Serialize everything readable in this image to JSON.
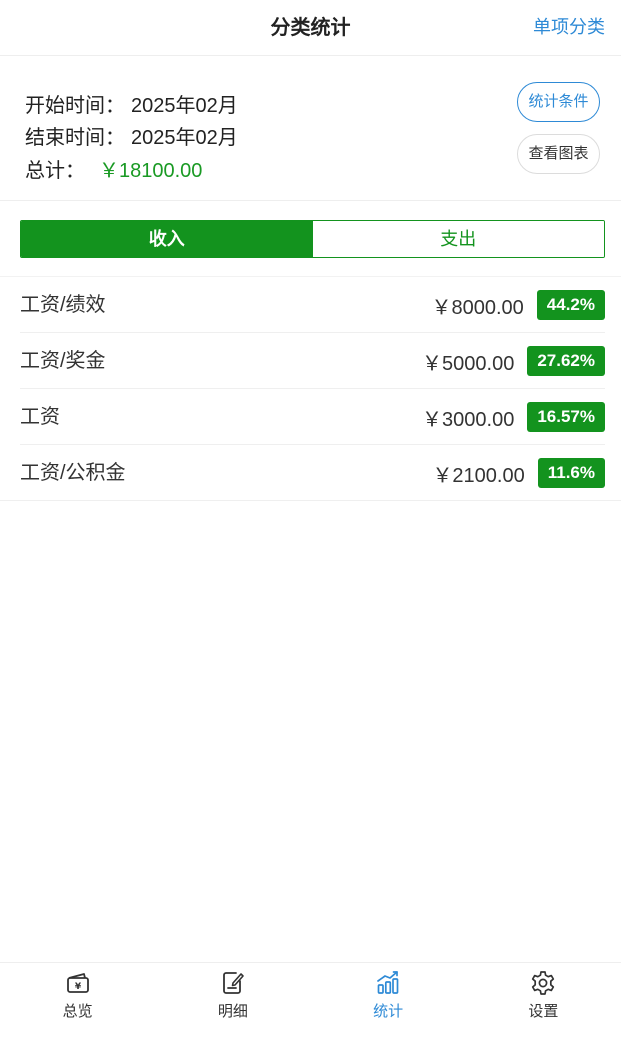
{
  "navbar": {
    "title": "分类统计",
    "right_action": "单项分类"
  },
  "summary": {
    "start_label": "开始时间：",
    "start_value": "2025年02月",
    "end_label": "结束时间：",
    "end_value": "2025年02月",
    "total_label": "总计：",
    "total_value": "￥18100.00",
    "condition_button": "统计条件",
    "chart_button": "查看图表"
  },
  "segments": {
    "income": "收入",
    "expense": "支出",
    "active": "income"
  },
  "items": [
    {
      "name": "工资/绩效",
      "amount": "￥8000.00",
      "percent": "44.2%"
    },
    {
      "name": "工资/奖金",
      "amount": "￥5000.00",
      "percent": "27.62%"
    },
    {
      "name": "工资",
      "amount": "￥3000.00",
      "percent": "16.57%"
    },
    {
      "name": "工资/公积金",
      "amount": "￥2100.00",
      "percent": "11.6%"
    }
  ],
  "tabbar": {
    "items": [
      {
        "label": "总览",
        "icon": "wallet-icon"
      },
      {
        "label": "明细",
        "icon": "edit-document-icon"
      },
      {
        "label": "统计",
        "icon": "bar-chart-icon"
      },
      {
        "label": "设置",
        "icon": "gear-icon"
      }
    ],
    "active": "统计"
  },
  "colors": {
    "accent_green": "#13931e",
    "total_green": "#1a9a24",
    "link_blue": "#2e8ad6"
  }
}
